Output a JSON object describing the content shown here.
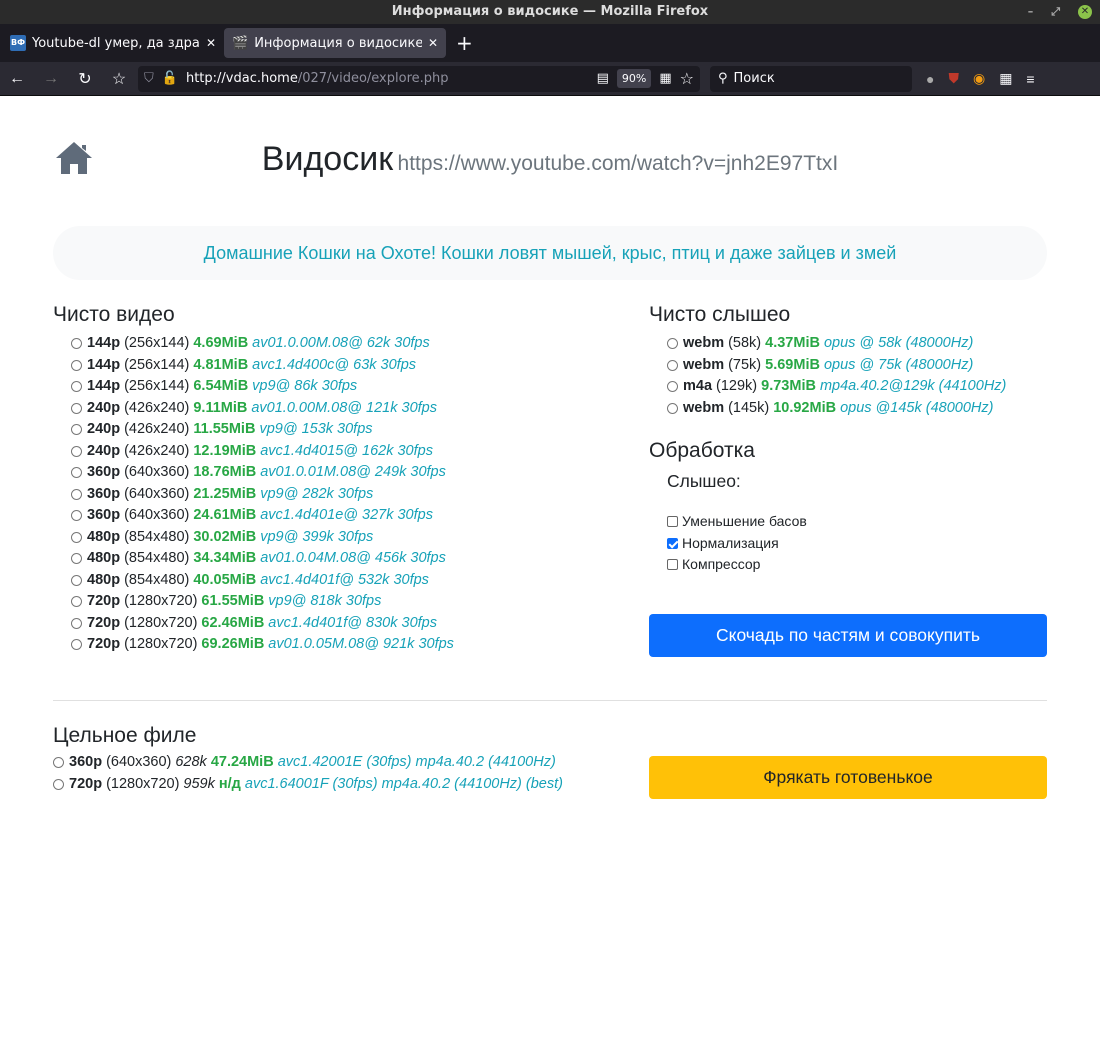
{
  "window": {
    "title": "Информация о видосике — Mozilla Firefox"
  },
  "tabs": [
    {
      "label": "Youtube-dl умер, да здравствует",
      "favicon": "ВФ"
    },
    {
      "label": "Информация о видосике"
    }
  ],
  "navbar": {
    "url_host": "http://vdac.home",
    "url_path": "/027/video/explore.php",
    "zoom": "90%",
    "search_placeholder": "Поиск"
  },
  "page": {
    "title": "Видосик",
    "url": "https://www.youtube.com/watch?v=jnh2E97TtxI",
    "video_title": "Домашние Кошки на Охоте! Кошки ловят мышей, крыс, птиц и даже зайцев и змей"
  },
  "video": {
    "heading": "Чисто видео",
    "items": [
      {
        "q": "144p",
        "res": "(256x144)",
        "size": "4.69MiB",
        "codec": "av01.0.00M.08@ 62k 30fps"
      },
      {
        "q": "144p",
        "res": "(256x144)",
        "size": "4.81MiB",
        "codec": "avc1.4d400c@ 63k 30fps"
      },
      {
        "q": "144p",
        "res": "(256x144)",
        "size": "6.54MiB",
        "codec": "vp9@ 86k 30fps"
      },
      {
        "q": "240p",
        "res": "(426x240)",
        "size": "9.11MiB",
        "codec": "av01.0.00M.08@ 121k 30fps"
      },
      {
        "q": "240p",
        "res": "(426x240)",
        "size": "11.55MiB",
        "codec": "vp9@ 153k 30fps"
      },
      {
        "q": "240p",
        "res": "(426x240)",
        "size": "12.19MiB",
        "codec": "avc1.4d4015@ 162k 30fps"
      },
      {
        "q": "360p",
        "res": "(640x360)",
        "size": "18.76MiB",
        "codec": "av01.0.01M.08@ 249k 30fps"
      },
      {
        "q": "360p",
        "res": "(640x360)",
        "size": "21.25MiB",
        "codec": "vp9@ 282k 30fps"
      },
      {
        "q": "360p",
        "res": "(640x360)",
        "size": "24.61MiB",
        "codec": "avc1.4d401e@ 327k 30fps"
      },
      {
        "q": "480p",
        "res": "(854x480)",
        "size": "30.02MiB",
        "codec": "vp9@ 399k 30fps"
      },
      {
        "q": "480p",
        "res": "(854x480)",
        "size": "34.34MiB",
        "codec": "av01.0.04M.08@ 456k 30fps"
      },
      {
        "q": "480p",
        "res": "(854x480)",
        "size": "40.05MiB",
        "codec": "avc1.4d401f@ 532k 30fps"
      },
      {
        "q": "720p",
        "res": "(1280x720)",
        "size": "61.55MiB",
        "codec": "vp9@ 818k 30fps"
      },
      {
        "q": "720p",
        "res": "(1280x720)",
        "size": "62.46MiB",
        "codec": "avc1.4d401f@ 830k 30fps"
      },
      {
        "q": "720p",
        "res": "(1280x720)",
        "size": "69.26MiB",
        "codec": "av01.0.05M.08@ 921k 30fps"
      }
    ]
  },
  "audio": {
    "heading": "Чисто слышео",
    "items": [
      {
        "q": "webm",
        "res": "(58k)",
        "size": "4.37MiB",
        "codec": "opus @ 58k (48000Hz)"
      },
      {
        "q": "webm",
        "res": "(75k)",
        "size": "5.69MiB",
        "codec": "opus @ 75k (48000Hz)"
      },
      {
        "q": "m4a",
        "res": "(129k)",
        "size": "9.73MiB",
        "codec": "mp4a.40.2@129k (44100Hz)"
      },
      {
        "q": "webm",
        "res": "(145k)",
        "size": "10.92MiB",
        "codec": "opus @145k (48000Hz)"
      }
    ]
  },
  "processing": {
    "heading": "Обработка",
    "subheading": "Слышео:",
    "options": [
      {
        "label": "Уменьшение басов",
        "checked": false
      },
      {
        "label": "Нормализация",
        "checked": true
      },
      {
        "label": "Компрессор",
        "checked": false
      }
    ],
    "button": "Скочадь по частям и совокупить",
    "button_color": "#0d6efd"
  },
  "whole": {
    "heading": "Цельное филе",
    "items": [
      {
        "q": "360p",
        "res": "(640x360)",
        "bitrate": "628k",
        "size": "47.24MiB",
        "codec": "avc1.42001E (30fps) mp4a.40.2 (44100Hz)"
      },
      {
        "q": "720p",
        "res": "(1280x720)",
        "bitrate": "959k",
        "size": "н/д",
        "codec": "avc1.64001F (30fps) mp4a.40.2 (44100Hz) (best)"
      }
    ],
    "button": "Фрякать готовенькое",
    "button_color": "#ffc107"
  }
}
